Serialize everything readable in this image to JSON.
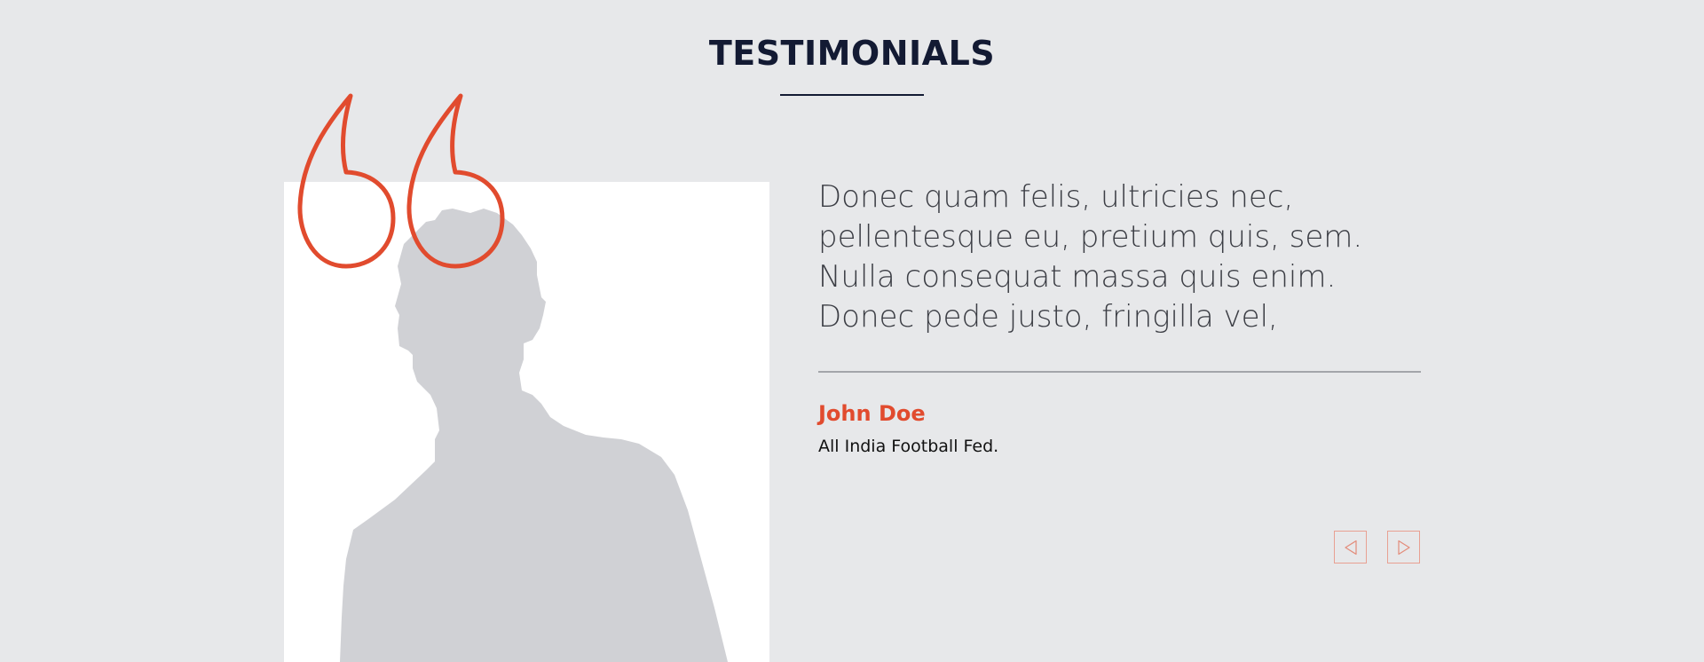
{
  "header": {
    "title": "TESTIMONIALS"
  },
  "testimonial": {
    "quote_lines": [
      "Donec quam felis, ultricies nec,",
      "pellentesque eu, pretium quis, sem.",
      "Nulla consequat massa quis enim.",
      "Donec pede justo, fringilla vel,"
    ],
    "author_name": "John Doe",
    "author_org": "All India Football Fed."
  },
  "icons": {
    "quote": "quote-icon",
    "prev": "triangle-left-icon",
    "next": "triangle-right-icon"
  },
  "colors": {
    "background": "#e7e8ea",
    "title": "#131a33",
    "accent": "#e14b2e",
    "body_text": "#3b3d44",
    "silhouette": "#d0d1d5"
  }
}
